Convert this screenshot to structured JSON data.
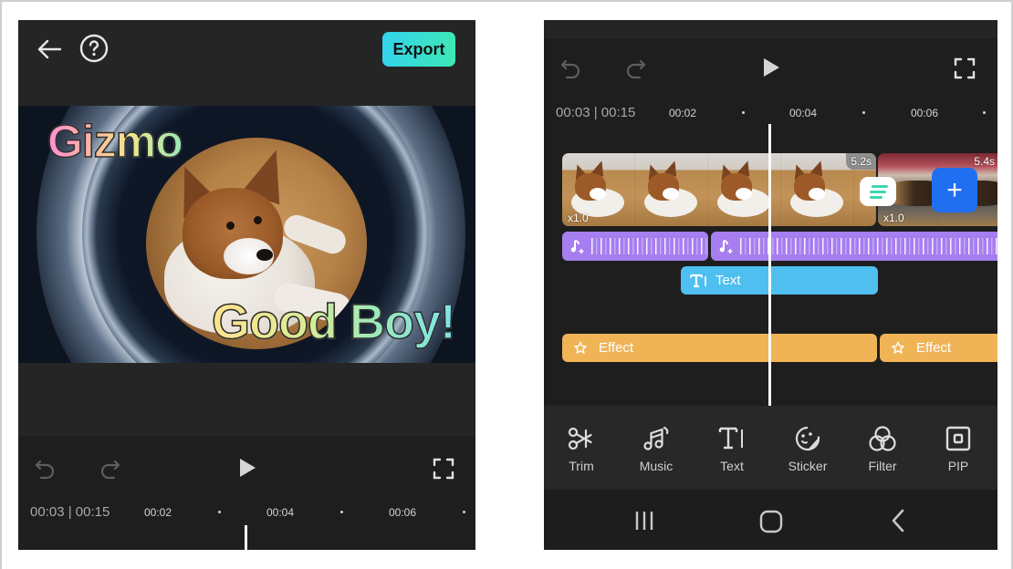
{
  "left_screen": {
    "header": {
      "back_icon": "arrow-left-icon",
      "help_icon": "question-circle-icon",
      "export_label": "Export"
    },
    "preview": {
      "captions": [
        "Gizmo",
        "Good Boy!"
      ]
    },
    "playback": {
      "undo_icon": "undo-icon",
      "redo_icon": "redo-icon",
      "play_icon": "play-icon",
      "fullscreen_icon": "fullscreen-icon",
      "timecode": "00:03 | 00:15",
      "ruler_labels": [
        "00:02",
        "00:04",
        "00:06"
      ]
    }
  },
  "right_screen": {
    "playback": {
      "undo_icon": "undo-icon",
      "redo_icon": "redo-icon",
      "play_icon": "play-icon",
      "fullscreen_icon": "fullscreen-icon",
      "timecode": "00:03 | 00:15",
      "ruler_labels": [
        "00:02",
        "00:04",
        "00:06"
      ]
    },
    "timeline": {
      "video_clips": [
        {
          "duration": "5.2s",
          "speed": "x1.0"
        },
        {
          "duration": "5.4s",
          "speed": "x1.0"
        }
      ],
      "transition_icon": "transition-icon",
      "add_clip_label": "+",
      "audio_clips": [
        {
          "icon": "music-add-icon"
        },
        {
          "icon": "music-add-icon"
        }
      ],
      "text_clip": {
        "label": "Text",
        "icon": "text-cursor-icon"
      },
      "effect_clips": [
        {
          "label": "Effect",
          "icon": "sparkle-star-icon"
        },
        {
          "label": "Effect",
          "icon": "sparkle-star-icon"
        }
      ]
    },
    "toolbar": {
      "items": [
        {
          "label": "Trim",
          "icon": "scissors-icon"
        },
        {
          "label": "Music",
          "icon": "music-notes-icon"
        },
        {
          "label": "Text",
          "icon": "text-icon"
        },
        {
          "label": "Sticker",
          "icon": "sticker-face-icon"
        },
        {
          "label": "Filter",
          "icon": "filter-circles-icon"
        },
        {
          "label": "PIP",
          "icon": "picture-in-picture-icon"
        }
      ]
    },
    "navbar": {
      "recents_icon": "recent-apps-icon",
      "home_icon": "home-icon",
      "back_icon": "back-chevron-icon"
    }
  },
  "colors": {
    "export_gradient_start": "#34d3ec",
    "export_gradient_end": "#3ee8b5",
    "add_button": "#1f6ff0",
    "audio_clip": "#a77ef0",
    "text_clip": "#4fbff0",
    "effect_clip": "#f0b457",
    "background_dark": "#1e1e1e"
  }
}
